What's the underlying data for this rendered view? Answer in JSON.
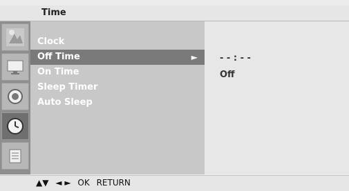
{
  "header": {
    "title": "Time"
  },
  "sidebar": {
    "icons": [
      {
        "name": "picture-icon",
        "active": false
      },
      {
        "name": "screen-icon",
        "active": false
      },
      {
        "name": "audio-icon",
        "active": false
      },
      {
        "name": "time-icon",
        "active": true
      },
      {
        "name": "option-icon",
        "active": false
      }
    ]
  },
  "menu": {
    "items": [
      {
        "label": "Clock"
      },
      {
        "label": "Off Time"
      },
      {
        "label": "On Time"
      },
      {
        "label": "Sleep Timer"
      },
      {
        "label": "Auto Sleep"
      }
    ],
    "selected_arrow": "►"
  },
  "value_panel": {
    "time": "- - : - -",
    "state": "Off"
  },
  "footer": {
    "up_down": "▲▼",
    "left_right": "◄ ►",
    "ok": "OK",
    "return": "RETURN"
  }
}
